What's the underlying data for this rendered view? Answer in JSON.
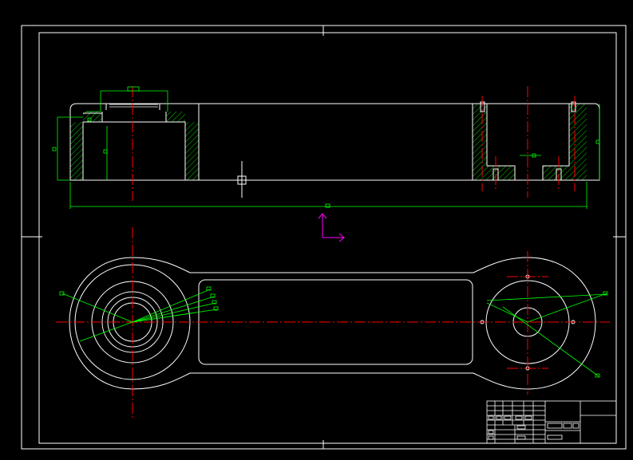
{
  "drawing": {
    "background": "#000000",
    "colors": {
      "outline": "#ffffff",
      "centerline": "#ff0000",
      "dimension": "#00ff00",
      "ucs": "#ff00ff",
      "hatch": "#00ff00"
    },
    "views": [
      "front-section-view",
      "top-view"
    ],
    "icons": [
      "ucs-icon",
      "crosshair-cursor"
    ]
  }
}
